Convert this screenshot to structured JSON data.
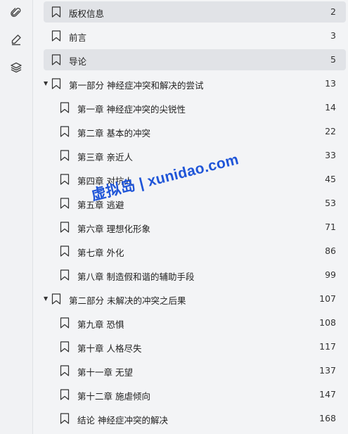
{
  "sidebar_icons": [
    "paperclip-icon",
    "pen-icon",
    "layers-icon"
  ],
  "toc": [
    {
      "label": "版权信息",
      "page": "2",
      "level": 0,
      "highlight": true,
      "caret": false
    },
    {
      "label": "前言",
      "page": "3",
      "level": 0,
      "highlight": false,
      "caret": false
    },
    {
      "label": "导论",
      "page": "5",
      "level": 0,
      "highlight": true,
      "caret": false
    },
    {
      "label": "第一部分 神经症冲突和解决的尝试",
      "page": "13",
      "level": 0,
      "highlight": false,
      "caret": true
    },
    {
      "label": "第一章 神经症冲突的尖锐性",
      "page": "14",
      "level": 1,
      "highlight": false,
      "caret": false
    },
    {
      "label": "第二章 基本的冲突",
      "page": "22",
      "level": 1,
      "highlight": false,
      "caret": false
    },
    {
      "label": "第三章 亲近人",
      "page": "33",
      "level": 1,
      "highlight": false,
      "caret": false
    },
    {
      "label": "第四章 对抗人",
      "page": "45",
      "level": 1,
      "highlight": false,
      "caret": false
    },
    {
      "label": "第五章 逃避",
      "page": "53",
      "level": 1,
      "highlight": false,
      "caret": false
    },
    {
      "label": "第六章 理想化形象",
      "page": "71",
      "level": 1,
      "highlight": false,
      "caret": false
    },
    {
      "label": "第七章 外化",
      "page": "86",
      "level": 1,
      "highlight": false,
      "caret": false
    },
    {
      "label": "第八章 制造假和谐的辅助手段",
      "page": "99",
      "level": 1,
      "highlight": false,
      "caret": false
    },
    {
      "label": "第二部分 未解决的冲突之后果",
      "page": "107",
      "level": 0,
      "highlight": false,
      "caret": true
    },
    {
      "label": "第九章 恐惧",
      "page": "108",
      "level": 1,
      "highlight": false,
      "caret": false
    },
    {
      "label": "第十章 人格尽失",
      "page": "117",
      "level": 1,
      "highlight": false,
      "caret": false
    },
    {
      "label": "第十一章 无望",
      "page": "137",
      "level": 1,
      "highlight": false,
      "caret": false
    },
    {
      "label": "第十二章 施虐倾向",
      "page": "147",
      "level": 1,
      "highlight": false,
      "caret": false
    },
    {
      "label": "结论 神经症冲突的解决",
      "page": "168",
      "level": 1,
      "highlight": false,
      "caret": false
    }
  ],
  "watermark": "虚拟岛 | xunidao.com",
  "colors": {
    "highlight": "#e1e3e7",
    "watermark": "#1f55d8"
  }
}
